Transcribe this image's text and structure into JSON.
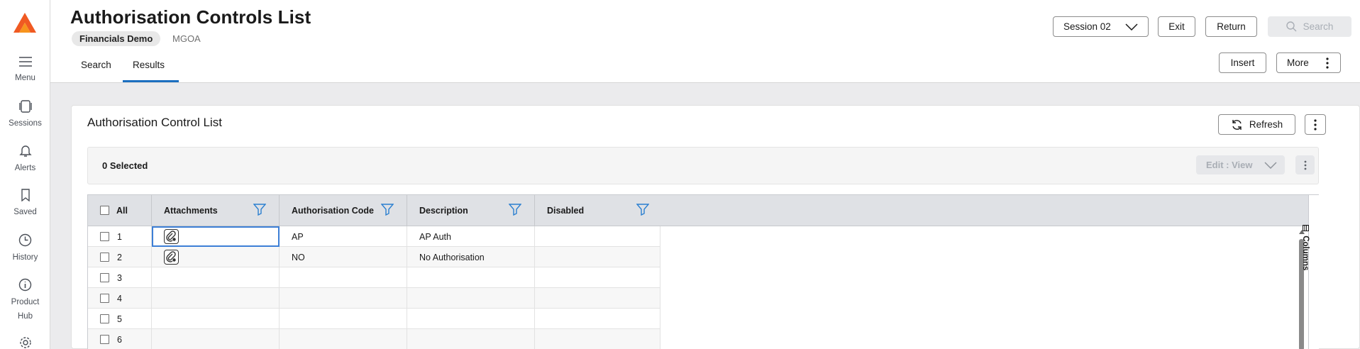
{
  "sidebar": {
    "items": [
      {
        "label": "Menu",
        "icon": "menu-icon"
      },
      {
        "label": "Sessions",
        "icon": "sessions-icon"
      },
      {
        "label": "Alerts",
        "icon": "bell-icon"
      },
      {
        "label": "Saved",
        "icon": "bookmark-icon"
      },
      {
        "label": "History",
        "icon": "clock-icon"
      },
      {
        "label": "Product",
        "label2": "Hub",
        "icon": "info-icon"
      }
    ]
  },
  "header": {
    "title": "Authorisation Controls List",
    "environment": "Financials Demo",
    "code": "MGOA",
    "tabs": [
      {
        "label": "Search"
      },
      {
        "label": "Results"
      }
    ],
    "active_tab": "Results",
    "session_label": "Session 02",
    "exit_label": "Exit",
    "return_label": "Return",
    "search_label": "Search",
    "insert_label": "Insert",
    "more_label": "More"
  },
  "card": {
    "title": "Authorisation Control List",
    "refresh_label": "Refresh",
    "selected_text": "0 Selected",
    "edit_view_label": "Edit : View"
  },
  "grid": {
    "select_all_label": "All",
    "columns": [
      "Attachments",
      "Authorisation Code",
      "Description",
      "Disabled"
    ],
    "side_label": "Columns",
    "rows": [
      {
        "num": "1",
        "attachment": true,
        "code": "AP",
        "description": "AP Auth",
        "disabled": ""
      },
      {
        "num": "2",
        "attachment": true,
        "code": "NO",
        "description": "No Authorisation",
        "disabled": ""
      },
      {
        "num": "3",
        "attachment": false,
        "code": "",
        "description": "",
        "disabled": ""
      },
      {
        "num": "4",
        "attachment": false,
        "code": "",
        "description": "",
        "disabled": ""
      },
      {
        "num": "5",
        "attachment": false,
        "code": "",
        "description": "",
        "disabled": ""
      },
      {
        "num": "6",
        "attachment": false,
        "code": "",
        "description": "",
        "disabled": ""
      }
    ]
  },
  "colors": {
    "accent": "#1b6fc0",
    "logo_orange": "#f05a22",
    "header_row": "#dfe1e5",
    "filter_icon": "#2a7fd0"
  }
}
